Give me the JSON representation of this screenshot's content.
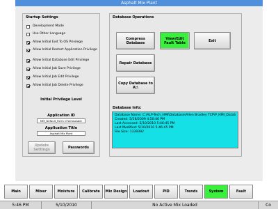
{
  "window": {
    "title": "Asphalt Mix Plant"
  },
  "startup": {
    "title": "Startup Settings",
    "options": [
      {
        "label": "Development Mode",
        "checked": false
      },
      {
        "label": "Use Other Language",
        "checked": false
      },
      {
        "label": "Allow Initial Exit To OS Privilege",
        "checked": true
      },
      {
        "label": "Allow Initial Restart Application Privilege",
        "checked": true
      },
      {
        "label": "Allow Initial Database Edit Privilege",
        "checked": true
      },
      {
        "label": "Allow Initial Job Save Privilege",
        "checked": true
      },
      {
        "label": "Allow Initial Job Edit Privilege",
        "checked": true
      },
      {
        "label": "Allow Initial Job Delete Privilege",
        "checked": true
      }
    ],
    "privilege_label": "Initial Privilege Level",
    "app_id_label": "Application ID",
    "app_id_value": "MM_Default_Form CFormLoader",
    "app_title_label": "Application Title",
    "app_title_value": "Asphalt Mix Plant",
    "update_label": "Update Settings",
    "passwords_label": "Passwords"
  },
  "db": {
    "title": "Database Operations",
    "compress_label": "Compress Database",
    "view_fault_label": "View/Edit Fault Table",
    "exit_label": "Exit",
    "repair_label": "Repair Database",
    "copy_label": "Copy Database to A:\\",
    "info_title": "Database Info:",
    "info_lines": [
      "Database Name: C:\\ALP-Tech_HMI\\Database\\Allen Bradley TCP\\P_HMI_Datab",
      "Created: 5/18/2009 4:50:46 PM",
      "Last Accessed: 5/10/2010 5:46:45 PM",
      "Last Modified: 5/10/2010 5:46:45 PM",
      "File Size: 1339392"
    ]
  },
  "nav": {
    "items": [
      {
        "label": "Main",
        "active": false
      },
      {
        "label": "Mixer",
        "active": false
      },
      {
        "label": "Moisture",
        "active": false
      },
      {
        "label": "Calibrate",
        "active": false
      },
      {
        "label": "Mix Design",
        "active": false
      },
      {
        "label": "Loadout",
        "active": false
      },
      {
        "label": "PID",
        "active": false
      },
      {
        "label": "Trends",
        "active": false
      },
      {
        "label": "System",
        "active": true
      },
      {
        "label": "Fault",
        "active": false
      }
    ]
  },
  "status": {
    "time": "5:46 PM",
    "date": "5/10/2010",
    "mix": "No Active Mix Loaded",
    "extra": "Co"
  }
}
